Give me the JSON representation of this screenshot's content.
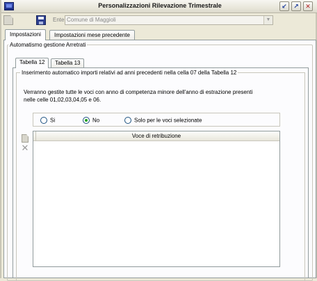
{
  "window": {
    "title": "Personalizzazioni Rilevazione Trimestrale",
    "controls": {
      "minimize": "↙",
      "maximize": "↗",
      "close": "✕"
    }
  },
  "toolbar": {
    "ente_label": "Ente",
    "ente_value": "Comune di Maggioli",
    "dropdown_arrow": "▼"
  },
  "tabs": [
    {
      "label": "Impostazioni",
      "active": true
    },
    {
      "label": "Impostazioni mese precedente",
      "active": false
    }
  ],
  "group_outer": {
    "label": "Automatismo gestione Arretrati"
  },
  "inner_tabs": [
    {
      "label": "Tabella 12",
      "active": true
    },
    {
      "label": "Tabella 13",
      "active": false
    }
  ],
  "group_inner": {
    "label": "Inserimento automatico importi relativi ad anni precedenti nella cella 07 della Tabella 12"
  },
  "description": {
    "line1": "Verranno gestite tutte le voci con anno di competenza minore dell'anno di estrazione presenti",
    "line2": "nelle celle 01,02,03,04,05 e 06."
  },
  "radio_options": [
    {
      "label": "Si",
      "checked": false
    },
    {
      "label": "No",
      "checked": true
    },
    {
      "label": "Solo per le voci selezionate",
      "checked": false
    }
  ],
  "side_actions": {
    "delete_glyph": "✕"
  },
  "grid": {
    "columns": [
      "Voce di retribuzione"
    ]
  }
}
